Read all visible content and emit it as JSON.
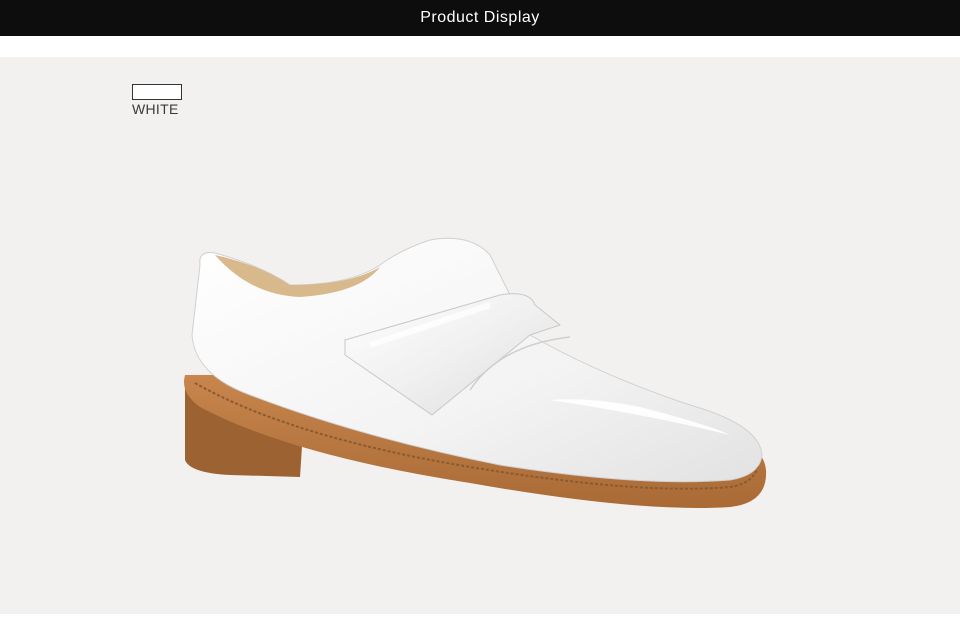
{
  "header": {
    "title": "Product Display",
    "background": "#0d0d0d",
    "text_color": "#ffffff"
  },
  "color_option": {
    "label": "WHITE",
    "swatch_color": "#ffffff"
  },
  "product": {
    "image": "white-patent-leather-monk-loafer",
    "colors": {
      "upper": "#f7f7f7",
      "sole": "#b87842",
      "background": "#f2f1ef"
    }
  }
}
